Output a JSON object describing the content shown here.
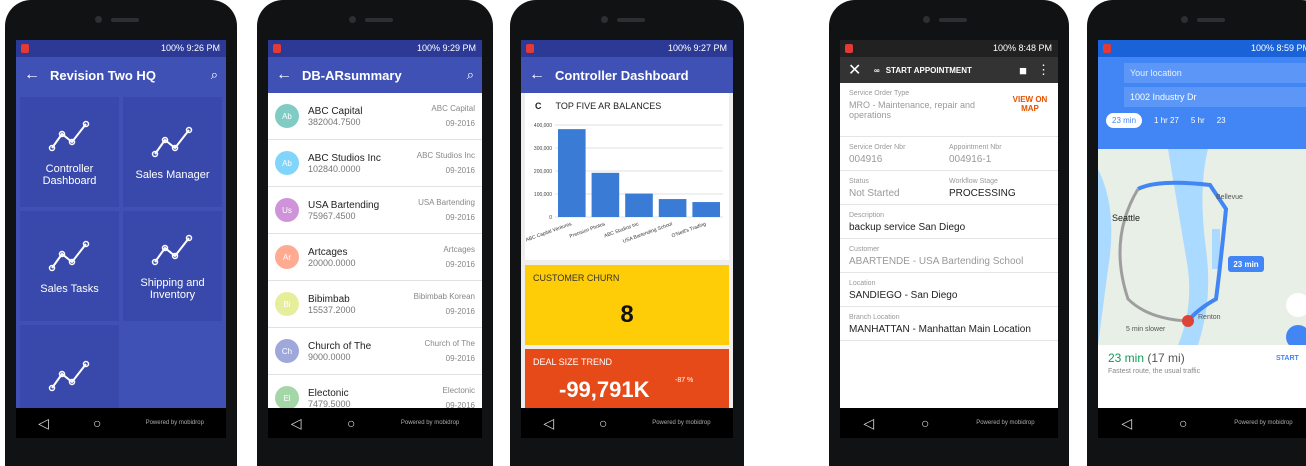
{
  "colors": {
    "primary": "#3f51b5",
    "tile": "#3949ab",
    "yellow": "#ffcd07",
    "orange": "#e64a19",
    "map_blue": "#4285f4"
  },
  "common": {
    "powered": "Powered by mobidrop"
  },
  "phone1": {
    "time": "100% 9:26 PM",
    "title": "Revision Two HQ",
    "tiles": [
      "Controller Dashboard",
      "Sales Manager",
      "Sales Tasks",
      "Shipping and Inventory"
    ]
  },
  "phone2": {
    "time": "100% 9:29 PM",
    "title": "DB-ARsummary",
    "rows": [
      {
        "initials": "Ab",
        "name": "ABC Capital",
        "value": "382004.7500",
        "right": "ABC Capital",
        "date": "09-2016",
        "color": "#80cbc4"
      },
      {
        "initials": "Ab",
        "name": "ABC Studios Inc",
        "value": "102840.0000",
        "right": "ABC Studios Inc",
        "date": "09-2016",
        "color": "#81d4fa"
      },
      {
        "initials": "Us",
        "name": "USA Bartending",
        "value": "75967.4500",
        "right": "USA Bartending",
        "date": "09-2016",
        "color": "#ce93d8"
      },
      {
        "initials": "Ar",
        "name": "Artcages",
        "value": "20000.0000",
        "right": "Artcages",
        "date": "09-2016",
        "color": "#ffab91"
      },
      {
        "initials": "Bi",
        "name": "Bibimbab",
        "value": "15537.2000",
        "right": "Bibimbab Korean",
        "date": "09-2016",
        "color": "#e6ee9c"
      },
      {
        "initials": "Ch",
        "name": "Church of The",
        "value": "9000.0000",
        "right": "Church of The",
        "date": "09-2016",
        "color": "#9fa8da"
      },
      {
        "initials": "El",
        "name": "Electonic",
        "value": "7479.5000",
        "right": "Electonic",
        "date": "09-2016",
        "color": "#a5d6a7"
      }
    ]
  },
  "phone3": {
    "time": "100% 9:27 PM",
    "title": "Controller Dashboard",
    "card_title": "TOP FIVE AR BALANCES",
    "churn_label": "CUSTOMER CHURN",
    "churn_value": "8",
    "deal_label": "DEAL SIZE TREND",
    "deal_value": "-99,791K",
    "deal_pct": "-87 %"
  },
  "chart_data": {
    "type": "bar",
    "categories": [
      "ABC Capital Ventures",
      "Precision Photos",
      "ABC Studios Inc",
      "USA Bartending School",
      "O'Neill's Trading"
    ],
    "values": [
      382000,
      192000,
      102000,
      78000,
      65000
    ],
    "ylim": [
      0,
      400000
    ],
    "yticks": [
      "400,000",
      "300,000",
      "200,000",
      "100,000",
      "0"
    ],
    "grid": true
  },
  "phone4": {
    "time": "100% 8:48 PM",
    "title": "START APPOINTMENT",
    "map_link": "VIEW ON MAP",
    "fields": {
      "type_label": "Service Order Type",
      "type_value": "MRO - Maintenance, repair and operations",
      "nbr_label": "Service Order Nbr",
      "nbr_value": "004916",
      "appt_label": "Appointment Nbr",
      "appt_value": "004916-1",
      "status_label": "Status",
      "status_value": "Not Started",
      "stage_label": "Workflow Stage",
      "stage_value": "PROCESSING",
      "desc_label": "Description",
      "desc_value": "backup service San Diego",
      "cust_label": "Customer",
      "cust_value": "ABARTENDE - USA Bartending School",
      "loc_label": "Location",
      "loc_value": "SANDIEGO - San Diego",
      "branch_label": "Branch Location",
      "branch_value": "MANHATTAN - Manhattan Main Location"
    }
  },
  "phone5": {
    "time": "100% 8:59 PM",
    "from": "Your location",
    "to": "1002 Industry Dr",
    "modes": [
      "23 min",
      "1 hr 27",
      "5 hr",
      "23"
    ],
    "city1": "Seattle",
    "city2": "Bellevue",
    "city3": "Renton",
    "route_badge": "23 min",
    "alt": "5 min slower",
    "eta": "23 min",
    "dist": "(17 mi)",
    "sub": "Fastest route, the usual traffic",
    "start": "START"
  }
}
